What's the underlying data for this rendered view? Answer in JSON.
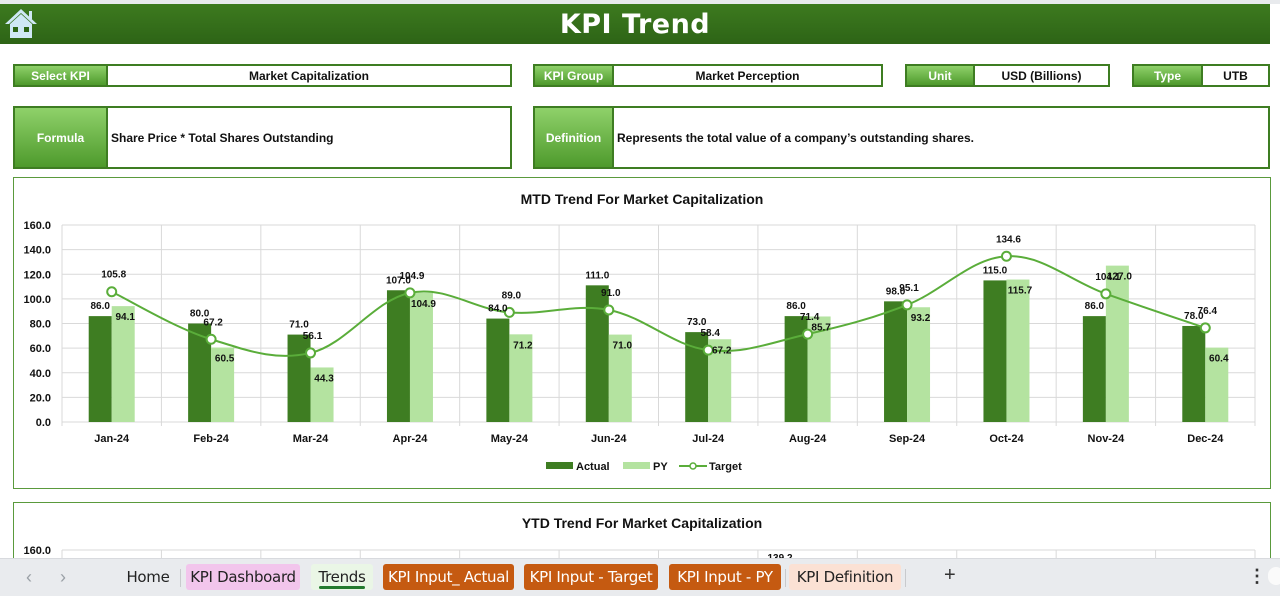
{
  "header": {
    "title": "KPI Trend",
    "home_icon": "home-icon"
  },
  "fields": {
    "select_kpi": {
      "label": "Select KPI",
      "value": "Market Capitalization"
    },
    "kpi_group": {
      "label": "KPI Group",
      "value": "Market Perception"
    },
    "unit": {
      "label": "Unit",
      "value": "USD (Billions)"
    },
    "type": {
      "label": "Type",
      "value": "UTB"
    },
    "formula": {
      "label": "Formula",
      "value": "Share Price * Total Shares Outstanding"
    },
    "definition": {
      "label": "Definition",
      "value": "Represents the total value of a company’s outstanding shares."
    }
  },
  "colors": {
    "actual": "#3e7d22",
    "py": "#b4e3a0",
    "target": "#5aad3a",
    "header": "#2d6416"
  },
  "chart_data": [
    {
      "type": "bar",
      "title": "MTD Trend For Market Capitalization",
      "xlabel": "",
      "ylabel": "",
      "ylim": [
        0,
        160
      ],
      "yticks": [
        "0.0",
        "20.0",
        "40.0",
        "60.0",
        "80.0",
        "100.0",
        "120.0",
        "140.0",
        "160.0"
      ],
      "grid": true,
      "legend_position": "bottom",
      "categories": [
        "Jan-24",
        "Feb-24",
        "Mar-24",
        "Apr-24",
        "May-24",
        "Jun-24",
        "Jul-24",
        "Aug-24",
        "Sep-24",
        "Oct-24",
        "Nov-24",
        "Dec-24"
      ],
      "series": [
        {
          "name": "Actual",
          "kind": "bar",
          "values": [
            86.0,
            80.0,
            71.0,
            107.0,
            84.0,
            111.0,
            73.0,
            86.0,
            98.0,
            115.0,
            86.0,
            78.0
          ]
        },
        {
          "name": "PY",
          "kind": "bar",
          "values": [
            94.1,
            60.5,
            44.3,
            104.9,
            71.2,
            71.0,
            67.2,
            85.7,
            93.2,
            115.7,
            127.0,
            60.4
          ]
        },
        {
          "name": "Target",
          "kind": "line",
          "values": [
            105.8,
            67.2,
            56.1,
            104.9,
            89.0,
            91.0,
            58.4,
            71.4,
            95.1,
            134.6,
            104.1,
            76.4
          ]
        }
      ]
    },
    {
      "type": "bar",
      "title": "YTD Trend For Market Capitalization",
      "visible_ytick": "160.0",
      "visible_label": "139.2"
    }
  ],
  "sheet_tabs": [
    {
      "label": "Home",
      "style": "plain"
    },
    {
      "label": "KPI Dashboard",
      "style": "pink"
    },
    {
      "label": "Trends",
      "style": "active"
    },
    {
      "label": "KPI Input_ Actual",
      "style": "orange"
    },
    {
      "label": "KPI Input - Target",
      "style": "orange"
    },
    {
      "label": "KPI Input - PY",
      "style": "orange"
    },
    {
      "label": "KPI Definition",
      "style": "peach"
    }
  ],
  "tabbar": {
    "prev": "‹",
    "next": "›",
    "add": "+",
    "more": "⋮"
  }
}
